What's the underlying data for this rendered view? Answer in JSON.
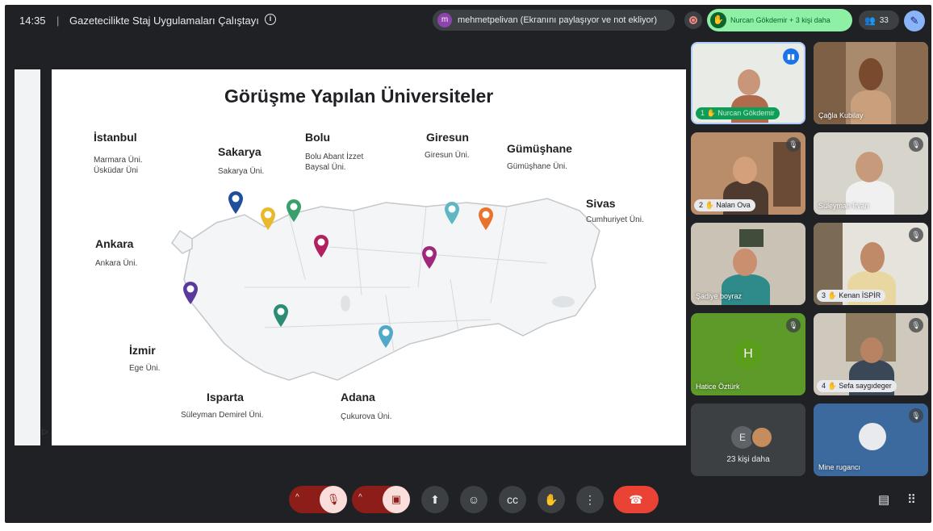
{
  "topbar": {
    "time": "14:35",
    "separator": "|",
    "meeting_title": "Gazetecilikte Staj Uygulamaları Çalıştayı",
    "info_icon": "info-icon",
    "presenter_initial": "m",
    "presenter_text": "mehmetpelivan (Ekranını paylaşıyor ve not ekliyor)",
    "hand_raise_text": "Nurcan Gökdemir + 3 kişi daha",
    "participant_count": "33"
  },
  "slide": {
    "title": "Görüşme Yapılan Üniversiteler",
    "cities": [
      {
        "name": "İstanbul",
        "unis": "Marmara Üni.\nÜsküdar Üni"
      },
      {
        "name": "Sakarya",
        "unis": "Sakarya Üni."
      },
      {
        "name": "Bolu",
        "unis": "Bolu Abant İzzet\nBaysal Üni."
      },
      {
        "name": "Giresun",
        "unis": "Giresun Üni."
      },
      {
        "name": "Gümüşhane",
        "unis": "Gümüşhane Üni."
      },
      {
        "name": "Sivas",
        "unis": "Cumhuriyet Üni."
      },
      {
        "name": "Ankara",
        "unis": "Ankara Üni."
      },
      {
        "name": "İzmir",
        "unis": "Ege Üni."
      },
      {
        "name": "Isparta",
        "unis": "Süleyman Demirel Üni."
      },
      {
        "name": "Adana",
        "unis": "Çukurova Üni."
      }
    ],
    "pin_colors": [
      "#1f4e9c",
      "#e8b92c",
      "#3aa06b",
      "#b0215e",
      "#5fb7c4",
      "#e8732c",
      "#a0287a",
      "#5b3a9e",
      "#2f8c74",
      "#4fa9c9"
    ]
  },
  "participants": [
    {
      "name": "Nurcan Gökdemir",
      "number": "1",
      "state": "speaking"
    },
    {
      "name": "Çağla Kubilay",
      "number": "",
      "state": "video"
    },
    {
      "name": "Nalan Ova",
      "number": "2",
      "state": "muted"
    },
    {
      "name": "Süleyman İrvan",
      "number": "",
      "state": "muted"
    },
    {
      "name": "Şadiye boyraz",
      "number": "",
      "state": "video"
    },
    {
      "name": "Kenan İSPİR",
      "number": "3",
      "state": "muted"
    },
    {
      "name": "Hatice Öztürk",
      "number": "",
      "state": "muted",
      "initial": "H"
    },
    {
      "name": "Sefa saygıdeger",
      "number": "4",
      "state": "muted"
    },
    {
      "name": "23 kişi daha",
      "initial": "E"
    },
    {
      "name": "Mine rugancı",
      "number": "",
      "state": "muted"
    }
  ],
  "controls": {
    "mic": "mic-off-icon",
    "camera": "camera-off-icon",
    "present": "present-icon",
    "emoji": "emoji-icon",
    "captions": "captions-icon",
    "hand": "hand-icon",
    "more": "more-icon",
    "hangup": "hangup-icon",
    "chat": "chat-icon",
    "activities": "grid-icon"
  }
}
